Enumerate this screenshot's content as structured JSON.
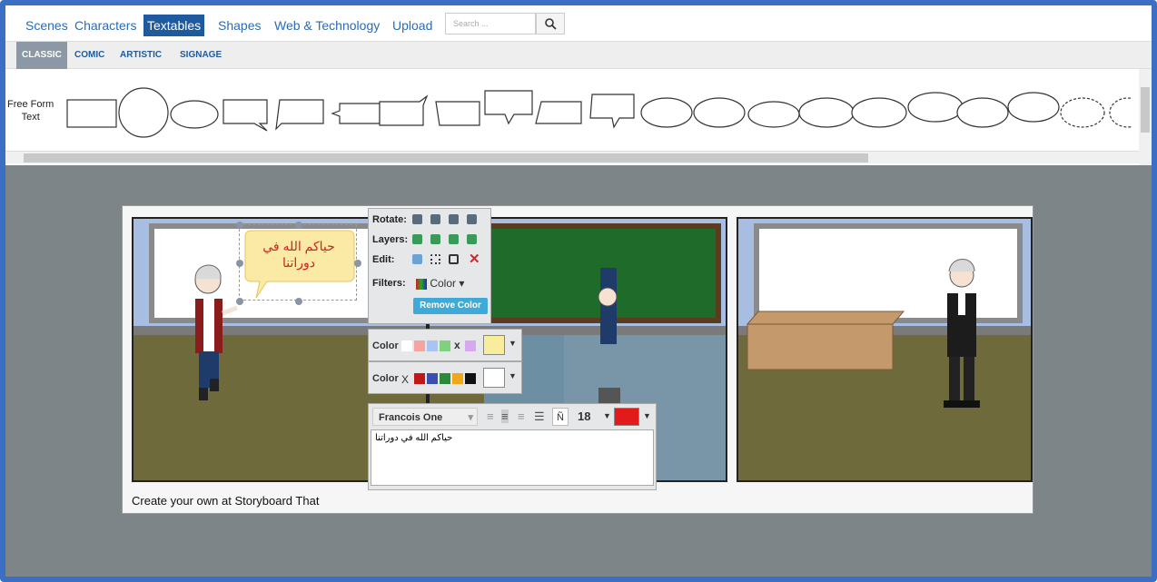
{
  "nav": {
    "tabs": [
      {
        "label": "Scenes"
      },
      {
        "label": "Characters"
      },
      {
        "label": "Textables"
      },
      {
        "label": "Shapes"
      },
      {
        "label": "Web & Technology"
      },
      {
        "label": "Upload"
      }
    ],
    "search_placeholder": "Search ..."
  },
  "subnav": {
    "tabs": [
      {
        "label": "CLASSIC"
      },
      {
        "label": "COMIC"
      },
      {
        "label": "ARTISTIC"
      },
      {
        "label": "SIGNAGE"
      }
    ]
  },
  "shelf": {
    "freeform_line1": "Free Form",
    "freeform_line2": "Text"
  },
  "board": {
    "credit": "Create your own at Storyboard That"
  },
  "bubble": {
    "line1": "حياكم الله في",
    "line2": "دوراتنا"
  },
  "toolbar": {
    "rotate_label": "Rotate:",
    "layers_label": "Layers:",
    "edit_label": "Edit:",
    "filters_label": "Filters:",
    "color_dropdown": "Color",
    "remove_color": "Remove Color"
  },
  "color_rows": [
    {
      "label": "Color",
      "clear": "x",
      "selected": "#f7ed9c"
    },
    {
      "label": "Color",
      "clear": "X",
      "selected": "#ffffff"
    }
  ],
  "text_editor": {
    "font": "Francois One",
    "size": "18",
    "text_color": "#e21a1a",
    "enye": "Ñ",
    "value": "حياكم الله في دوراتنا"
  },
  "colors": {
    "accent": "#1f5a9e",
    "frame": "#3b6fc4",
    "chalkboard": "#1f6b2a",
    "floor": "#6f6a3b"
  }
}
